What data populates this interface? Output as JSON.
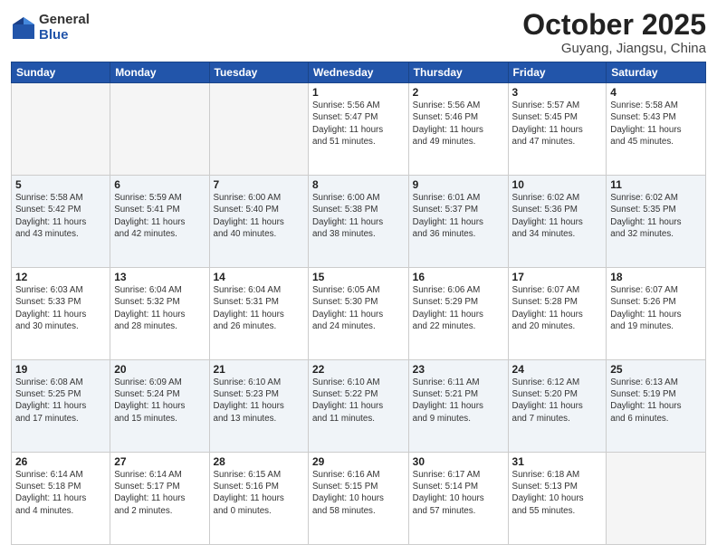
{
  "header": {
    "logo_general": "General",
    "logo_blue": "Blue",
    "month_title": "October 2025",
    "location": "Guyang, Jiangsu, China"
  },
  "weekdays": [
    "Sunday",
    "Monday",
    "Tuesday",
    "Wednesday",
    "Thursday",
    "Friday",
    "Saturday"
  ],
  "weeks": [
    [
      {
        "day": "",
        "info": ""
      },
      {
        "day": "",
        "info": ""
      },
      {
        "day": "",
        "info": ""
      },
      {
        "day": "1",
        "info": "Sunrise: 5:56 AM\nSunset: 5:47 PM\nDaylight: 11 hours\nand 51 minutes."
      },
      {
        "day": "2",
        "info": "Sunrise: 5:56 AM\nSunset: 5:46 PM\nDaylight: 11 hours\nand 49 minutes."
      },
      {
        "day": "3",
        "info": "Sunrise: 5:57 AM\nSunset: 5:45 PM\nDaylight: 11 hours\nand 47 minutes."
      },
      {
        "day": "4",
        "info": "Sunrise: 5:58 AM\nSunset: 5:43 PM\nDaylight: 11 hours\nand 45 minutes."
      }
    ],
    [
      {
        "day": "5",
        "info": "Sunrise: 5:58 AM\nSunset: 5:42 PM\nDaylight: 11 hours\nand 43 minutes."
      },
      {
        "day": "6",
        "info": "Sunrise: 5:59 AM\nSunset: 5:41 PM\nDaylight: 11 hours\nand 42 minutes."
      },
      {
        "day": "7",
        "info": "Sunrise: 6:00 AM\nSunset: 5:40 PM\nDaylight: 11 hours\nand 40 minutes."
      },
      {
        "day": "8",
        "info": "Sunrise: 6:00 AM\nSunset: 5:38 PM\nDaylight: 11 hours\nand 38 minutes."
      },
      {
        "day": "9",
        "info": "Sunrise: 6:01 AM\nSunset: 5:37 PM\nDaylight: 11 hours\nand 36 minutes."
      },
      {
        "day": "10",
        "info": "Sunrise: 6:02 AM\nSunset: 5:36 PM\nDaylight: 11 hours\nand 34 minutes."
      },
      {
        "day": "11",
        "info": "Sunrise: 6:02 AM\nSunset: 5:35 PM\nDaylight: 11 hours\nand 32 minutes."
      }
    ],
    [
      {
        "day": "12",
        "info": "Sunrise: 6:03 AM\nSunset: 5:33 PM\nDaylight: 11 hours\nand 30 minutes."
      },
      {
        "day": "13",
        "info": "Sunrise: 6:04 AM\nSunset: 5:32 PM\nDaylight: 11 hours\nand 28 minutes."
      },
      {
        "day": "14",
        "info": "Sunrise: 6:04 AM\nSunset: 5:31 PM\nDaylight: 11 hours\nand 26 minutes."
      },
      {
        "day": "15",
        "info": "Sunrise: 6:05 AM\nSunset: 5:30 PM\nDaylight: 11 hours\nand 24 minutes."
      },
      {
        "day": "16",
        "info": "Sunrise: 6:06 AM\nSunset: 5:29 PM\nDaylight: 11 hours\nand 22 minutes."
      },
      {
        "day": "17",
        "info": "Sunrise: 6:07 AM\nSunset: 5:28 PM\nDaylight: 11 hours\nand 20 minutes."
      },
      {
        "day": "18",
        "info": "Sunrise: 6:07 AM\nSunset: 5:26 PM\nDaylight: 11 hours\nand 19 minutes."
      }
    ],
    [
      {
        "day": "19",
        "info": "Sunrise: 6:08 AM\nSunset: 5:25 PM\nDaylight: 11 hours\nand 17 minutes."
      },
      {
        "day": "20",
        "info": "Sunrise: 6:09 AM\nSunset: 5:24 PM\nDaylight: 11 hours\nand 15 minutes."
      },
      {
        "day": "21",
        "info": "Sunrise: 6:10 AM\nSunset: 5:23 PM\nDaylight: 11 hours\nand 13 minutes."
      },
      {
        "day": "22",
        "info": "Sunrise: 6:10 AM\nSunset: 5:22 PM\nDaylight: 11 hours\nand 11 minutes."
      },
      {
        "day": "23",
        "info": "Sunrise: 6:11 AM\nSunset: 5:21 PM\nDaylight: 11 hours\nand 9 minutes."
      },
      {
        "day": "24",
        "info": "Sunrise: 6:12 AM\nSunset: 5:20 PM\nDaylight: 11 hours\nand 7 minutes."
      },
      {
        "day": "25",
        "info": "Sunrise: 6:13 AM\nSunset: 5:19 PM\nDaylight: 11 hours\nand 6 minutes."
      }
    ],
    [
      {
        "day": "26",
        "info": "Sunrise: 6:14 AM\nSunset: 5:18 PM\nDaylight: 11 hours\nand 4 minutes."
      },
      {
        "day": "27",
        "info": "Sunrise: 6:14 AM\nSunset: 5:17 PM\nDaylight: 11 hours\nand 2 minutes."
      },
      {
        "day": "28",
        "info": "Sunrise: 6:15 AM\nSunset: 5:16 PM\nDaylight: 11 hours\nand 0 minutes."
      },
      {
        "day": "29",
        "info": "Sunrise: 6:16 AM\nSunset: 5:15 PM\nDaylight: 10 hours\nand 58 minutes."
      },
      {
        "day": "30",
        "info": "Sunrise: 6:17 AM\nSunset: 5:14 PM\nDaylight: 10 hours\nand 57 minutes."
      },
      {
        "day": "31",
        "info": "Sunrise: 6:18 AM\nSunset: 5:13 PM\nDaylight: 10 hours\nand 55 minutes."
      },
      {
        "day": "",
        "info": ""
      }
    ]
  ]
}
